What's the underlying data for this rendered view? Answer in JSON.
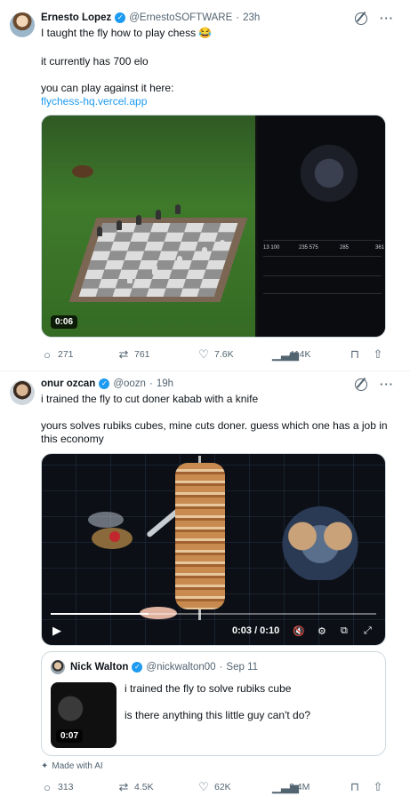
{
  "tweets": [
    {
      "author": {
        "name": "Ernesto Lopez",
        "handle": "@ErnestoSOFTWARE",
        "time": "23h"
      },
      "lines": [
        "I taught the fly how to play chess 😂",
        "it currently has 700 elo",
        "you can play against it here:"
      ],
      "link": "flychess-hq.vercel.app",
      "media": {
        "duration": "0:06",
        "stats": [
          "13 100",
          "235 575",
          "285",
          "361"
        ]
      },
      "actions": {
        "replies": "271",
        "retweets": "761",
        "likes": "7.6K",
        "views": "414K"
      }
    },
    {
      "author": {
        "name": "onur ozcan",
        "handle": "@oozn",
        "time": "19h"
      },
      "lines": [
        "i trained the fly to cut doner kabab with a knife",
        "yours solves rubiks cubes, mine cuts doner. guess which one has a job in",
        "this economy"
      ],
      "media": {
        "time_display": "0:03 / 0:10",
        "progress": 0.3
      },
      "quote": {
        "author": {
          "name": "Nick Walton",
          "handle": "@nickwalton00",
          "time": "Sep 11"
        },
        "lines": [
          "i trained the fly to solve rubiks cube",
          "is there anything this little guy can't do?"
        ],
        "duration": "0:07"
      },
      "made_with_ai": "Made with AI",
      "actions": {
        "replies": "313",
        "retweets": "4.5K",
        "likes": "62K",
        "views": "2.4M"
      }
    }
  ],
  "colors": {
    "accent": "#1d9bf0",
    "muted": "#536471",
    "text": "#0f1419",
    "border": "#cfd9de"
  },
  "icons": {
    "verified": "✓",
    "more": "···",
    "reply": "💬",
    "retweet": "⟲",
    "like": "♡",
    "views": "📊",
    "bookmark": "🔖",
    "share": "⇪",
    "play": "▶",
    "ai": "✦"
  }
}
